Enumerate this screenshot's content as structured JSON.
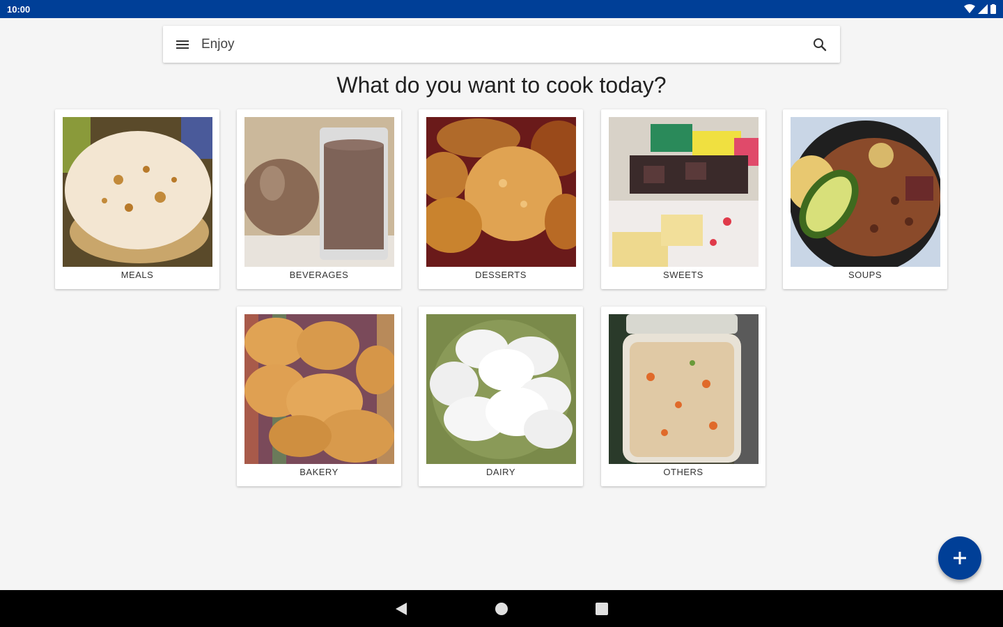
{
  "status_bar": {
    "time": "10:00"
  },
  "search_bar": {
    "text": "Enjoy"
  },
  "page_title": "What do you want to cook today?",
  "categories": [
    {
      "label": "MEALS"
    },
    {
      "label": "BEVERAGES"
    },
    {
      "label": "DESSERTS"
    },
    {
      "label": "SWEETS"
    },
    {
      "label": "SOUPS"
    },
    {
      "label": "BAKERY"
    },
    {
      "label": "DAIRY"
    },
    {
      "label": "OTHERS"
    }
  ],
  "fab": {
    "icon": "plus-icon"
  },
  "colors": {
    "primary": "#003f97",
    "background": "#f5f5f5"
  }
}
